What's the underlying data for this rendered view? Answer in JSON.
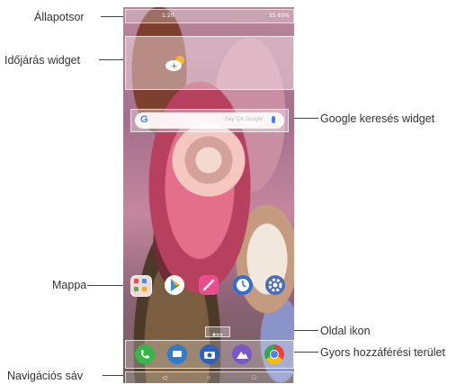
{
  "callouts": {
    "status_bar": "Állapotsor",
    "weather_widget": "Időjárás widget",
    "google_search_widget": "Google keresés widget",
    "folder": "Mappa",
    "page_icon": "Oldal ikon",
    "quick_access": "Gyors hozzáférési terület",
    "nav_bar": "Navigációs sáv"
  },
  "screen": {
    "status_time": "1:20",
    "battery": "55 60%",
    "search_placeholder": "Say 'Ok Google'"
  },
  "icons": {
    "weather": "cloud-sun-plus-icon",
    "folder": "app-folder-icon",
    "play_store": "play-store-icon",
    "note": "pen-note-icon",
    "clock": "clock-icon",
    "settings": "gear-icon",
    "phone": "phone-icon",
    "messages": "messages-icon",
    "camera": "camera-icon",
    "gallery": "gallery-icon",
    "chrome": "chrome-icon",
    "nav_back": "back-icon",
    "nav_home": "home-icon",
    "nav_recent": "recent-apps-icon"
  },
  "colors": {
    "line": "#444444",
    "phone_green": "#39b54a",
    "note_pink": "#e94d8e",
    "blue": "#2f6fd4"
  }
}
